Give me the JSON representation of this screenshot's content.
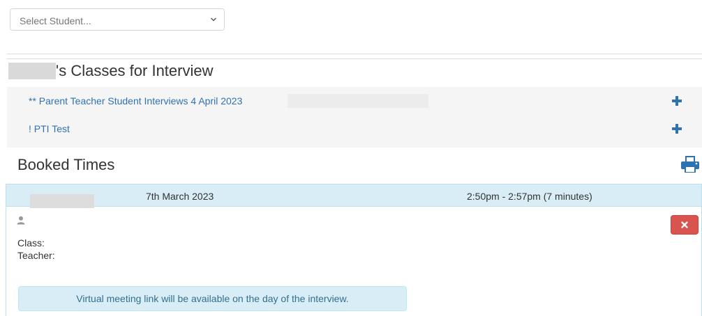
{
  "student_select": {
    "selected": "Select Student..."
  },
  "classes": {
    "heading_suffix": "'s Classes for Interview",
    "items": [
      {
        "label": "** Parent Teacher Student Interviews 4 April 2023"
      },
      {
        "label": "! PTI Test"
      }
    ]
  },
  "booked": {
    "heading": "Booked Times",
    "bookings": [
      {
        "date": "7th March 2023",
        "time": "2:50pm - 2:57pm (7 minutes)",
        "class_label": "Class:",
        "teacher_label": "Teacher:",
        "notice": "Virtual meeting link will be available on the day of the interview."
      }
    ]
  },
  "colors": {
    "link": "#2f72b0",
    "info_bg": "#d9edf7",
    "danger": "#d9534f"
  }
}
